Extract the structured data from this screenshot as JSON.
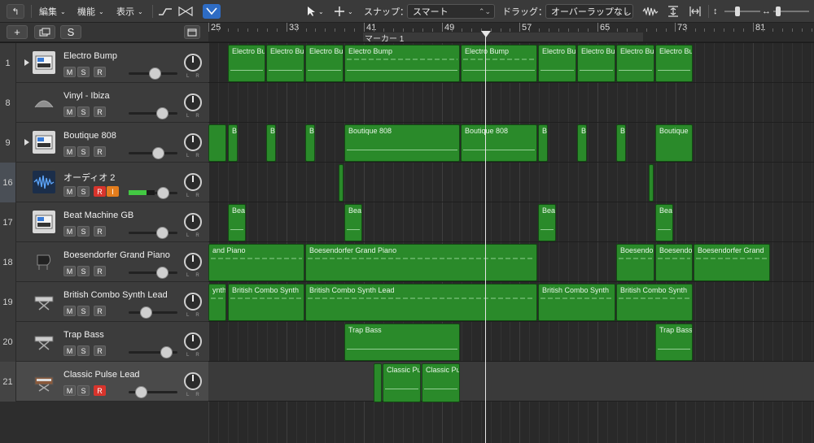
{
  "toolbar": {
    "edit": "編集",
    "functions": "機能",
    "view": "表示",
    "snap_label": "スナップ：",
    "snap_value": "スマート",
    "drag_label": "ドラッグ：",
    "drag_value": "オーバーラップなし"
  },
  "header": {
    "add": "+",
    "s_button": "S",
    "marker": "マーカー 1",
    "bars": [
      "25",
      "33",
      "41",
      "49",
      "57",
      "65",
      "73",
      "81"
    ]
  },
  "tracks": [
    {
      "num": "1",
      "name": "Electro Bump",
      "icon": "synth-keyboard-icon"
    },
    {
      "num": "8",
      "name": "Vinyl - Ibiza",
      "icon": "vinyl-icon"
    },
    {
      "num": "9",
      "name": "Boutique 808",
      "icon": "drum-machine-icon"
    },
    {
      "num": "16",
      "name": "オーディオ 2",
      "icon": "waveform-icon"
    },
    {
      "num": "17",
      "name": "Beat Machine GB",
      "icon": "drum-machine-icon"
    },
    {
      "num": "18",
      "name": "Boesendorfer Grand Piano",
      "icon": "grand-piano-icon"
    },
    {
      "num": "19",
      "name": "British Combo Synth Lead",
      "icon": "keyboard-stand-icon"
    },
    {
      "num": "20",
      "name": "Trap Bass",
      "icon": "keyboard-stand-icon"
    },
    {
      "num": "21",
      "name": "Classic Pulse Lead",
      "icon": "analog-synth-icon"
    }
  ],
  "track_buttons": {
    "mute": "M",
    "solo": "S",
    "record": "R",
    "input": "I"
  },
  "regions": {
    "electro": [
      "Electro Bu",
      "Electro Bu",
      "Electro Bu",
      "Electro Bump",
      "Electro Bump",
      "Electro Bu",
      "Electro Bu",
      "Electro Bu",
      "Electro Bu"
    ],
    "boutique": [
      "B",
      "B",
      "B",
      "Boutique 808",
      "Boutique 808",
      "B",
      "B",
      "B",
      "Boutique"
    ],
    "beat": [
      "Beat",
      "Beat",
      "Beat",
      "Beat"
    ],
    "piano": [
      "and Piano",
      "Boesendorfer Grand Piano",
      "Boesendo",
      "Boesendo",
      "Boesendorfer Grand"
    ],
    "british": [
      "ynth",
      "British Combo Synth",
      "British Combo Synth Lead",
      "British Combo Synth",
      "British Combo Synth"
    ],
    "trap": [
      "Trap Bass",
      "Trap Bass"
    ],
    "pulse": [
      "Classic Pu",
      "Classic Pu"
    ]
  },
  "colors": {
    "region": "#2a8a2a",
    "accent": "#2e6cc4",
    "record": "#d8342c",
    "input": "#e37d1d"
  }
}
